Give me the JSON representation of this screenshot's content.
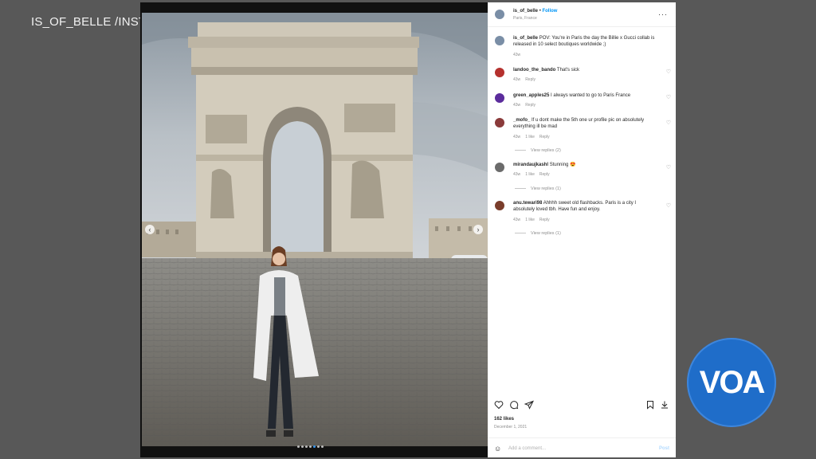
{
  "credit": "IS_OF_BELLE /INSTAGRAM",
  "post": {
    "username": "is_of_belle",
    "follow_label": "Follow",
    "location": "Paris, France",
    "more_label": "···"
  },
  "comments": [
    {
      "user": "is_of_belle",
      "text": "POV: You're in Paris the day the Billie x Gucci collab is released in 10 select boutiques worldwide ;)",
      "time": "43w",
      "likes": "",
      "reply": "",
      "replies": "",
      "avatar_color": "#7a8ea6"
    },
    {
      "user": "landoo_the_bando",
      "text": "That's sick",
      "time": "43w",
      "likes": "",
      "reply": "Reply",
      "replies": "",
      "avatar_color": "#b5312e"
    },
    {
      "user": "green_apples25",
      "text": "I always wanted to go to Paris France",
      "time": "43w",
      "likes": "",
      "reply": "Reply",
      "replies": "",
      "avatar_color": "#5b2c9c"
    },
    {
      "user": "_mofo_",
      "text": "If u dont make the 5th one ur profile pic on absolutely everything ill be mad",
      "time": "43w",
      "likes": "1 like",
      "reply": "Reply",
      "replies": "View replies (2)",
      "avatar_color": "#8a3a3a"
    },
    {
      "user": "mirandaujkashl",
      "text": "Stunning 😍",
      "time": "43w",
      "likes": "1 like",
      "reply": "Reply",
      "replies": "View replies (1)",
      "avatar_color": "#6b6b6b"
    },
    {
      "user": "anu.tewari98",
      "text": "Ahhhh sweet old flashbacks. Paris is a city I absolutely loved tbh. Have fun and enjoy.",
      "time": "43w",
      "likes": "1 like",
      "reply": "Reply",
      "replies": "View replies (1)",
      "avatar_color": "#7a3d2b"
    }
  ],
  "footer": {
    "likes": "162 likes",
    "date": "December 1, 2021",
    "add_comment_placeholder": "Add a comment...",
    "post_label": "Post"
  },
  "icons": {
    "heart": "heart-icon",
    "comment": "comment-icon",
    "share": "share-icon",
    "save": "bookmark-icon",
    "download": "download-icon",
    "emoji": "emoji-icon"
  },
  "logo": {
    "text": "VOA",
    "color": "#1f6dc9"
  },
  "carousel": {
    "slides": 7,
    "active_index": 4
  }
}
